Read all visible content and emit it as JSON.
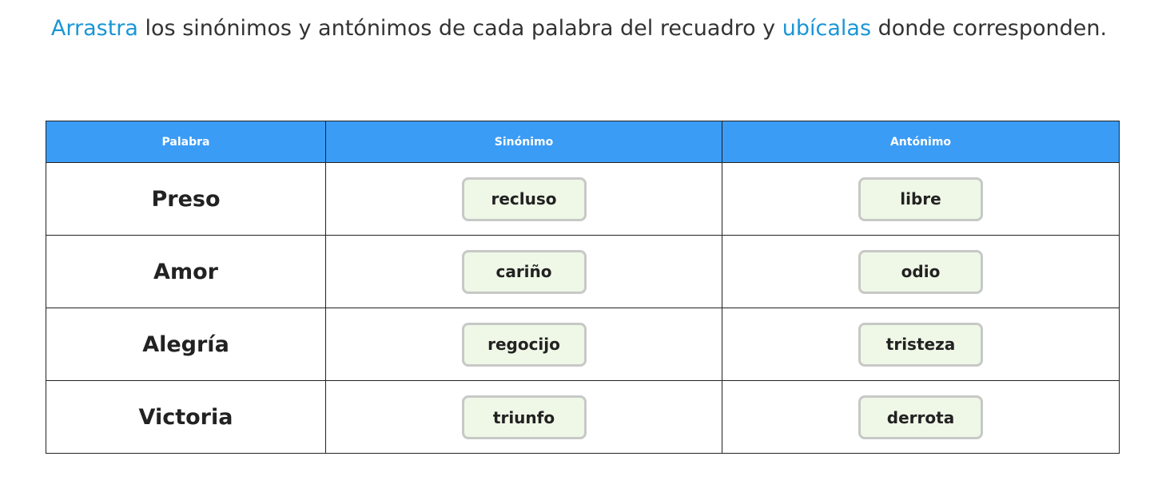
{
  "instruction": {
    "part1": "Arrastra",
    "part2": " los sinónimos y antónimos de cada palabra del recuadro y ",
    "part3": "ubícalas",
    "part4": " donde corresponden."
  },
  "colors": {
    "highlight": "#1a96d6",
    "header_bg": "#3b9cf5",
    "chip_bg": "#eff7e7",
    "chip_border": "#c7c9c7"
  },
  "table": {
    "headers": [
      "Palabra",
      "Sinónimo",
      "Antónimo"
    ],
    "rows": [
      {
        "word": "Preso",
        "synonym": "recluso",
        "antonym": "libre"
      },
      {
        "word": "Amor",
        "synonym": "cariño",
        "antonym": "odio"
      },
      {
        "word": "Alegría",
        "synonym": "regocijo",
        "antonym": "tristeza"
      },
      {
        "word": "Victoria",
        "synonym": "triunfo",
        "antonym": "derrota"
      }
    ]
  }
}
